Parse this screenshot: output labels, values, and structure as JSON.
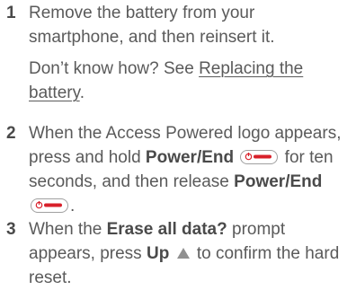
{
  "steps": [
    {
      "number": "1",
      "line1": "Remove the battery from your smartphone, and then reinsert it.",
      "sub_prefix": "Don’t know how? See ",
      "sub_link": "Replacing the battery",
      "sub_suffix": "."
    },
    {
      "number": "2",
      "t1": "When the Access Powered logo appears, press and hold ",
      "b1": "Power/End",
      "t2": " for ten seconds, and then release ",
      "b2": "Power/End",
      "t3": "."
    },
    {
      "number": "3",
      "t1": "When the ",
      "b1": "Erase all data?",
      "t2": " prompt appears, press ",
      "b2": "Up",
      "t3": " to confirm the hard reset."
    }
  ],
  "icons": {
    "power_end": "power-end-key-icon",
    "up": "up-arrow-icon"
  },
  "colors": {
    "text": "#5a5a5a",
    "key_red": "#d8202a",
    "key_border": "#a0a0a0"
  }
}
